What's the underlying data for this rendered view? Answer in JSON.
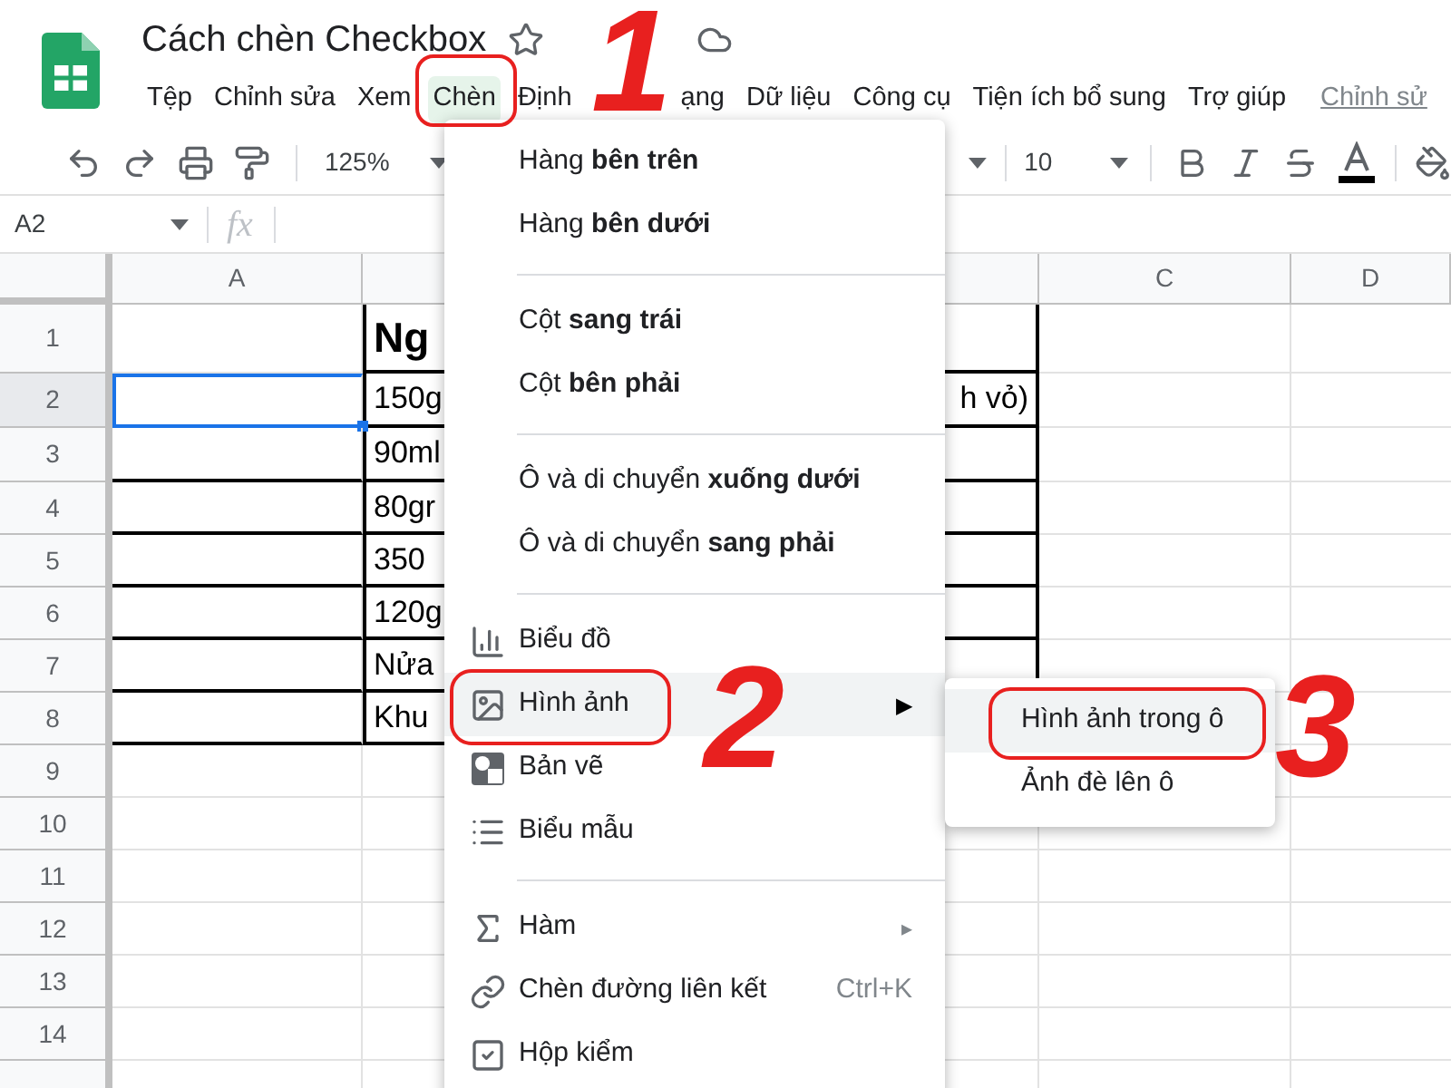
{
  "document": {
    "title": "Cách chèn Checkbox"
  },
  "menubar": [
    {
      "label": "Tệp",
      "selected": false
    },
    {
      "label": "Chỉnh sửa",
      "selected": false
    },
    {
      "label": "Xem",
      "selected": false
    },
    {
      "label": "Chèn",
      "selected": true
    },
    {
      "label": "Định",
      "label_end": "ạng",
      "selected": false
    },
    {
      "label": "Dữ liệu",
      "selected": false
    },
    {
      "label": "Công cụ",
      "selected": false
    },
    {
      "label": "Tiện ích bổ sung",
      "selected": false
    },
    {
      "label": "Trợ giúp",
      "selected": false
    }
  ],
  "last_edit_link": "Chỉnh sử",
  "toolbar": {
    "zoom": "125%",
    "font_size": "10"
  },
  "formula_bar": {
    "cell_ref": "A2",
    "fx_label": "fx"
  },
  "columns": [
    {
      "label": "A"
    },
    {},
    {
      "label": "C"
    },
    {
      "label": "D"
    }
  ],
  "rows": [
    {
      "number": "1",
      "selected": false,
      "column_b": "Ng",
      "bordered": true
    },
    {
      "number": "2",
      "selected": true,
      "column_b": "150g",
      "column_b_end": "h vỏ)",
      "bordered": true
    },
    {
      "number": "3",
      "selected": false,
      "column_b": "90ml",
      "bordered": true
    },
    {
      "number": "4",
      "selected": false,
      "column_b": "80gr",
      "bordered": true
    },
    {
      "number": "5",
      "selected": false,
      "column_b": "350",
      "bordered": true
    },
    {
      "number": "6",
      "selected": false,
      "column_b": "120g",
      "bordered": true
    },
    {
      "number": "7",
      "selected": false,
      "column_b": "Nửa",
      "bordered": true
    },
    {
      "number": "8",
      "selected": false,
      "column_b": "Khu",
      "bordered": true
    },
    {
      "number": "9",
      "selected": false,
      "bordered": false
    },
    {
      "number": "10",
      "selected": false,
      "bordered": false
    },
    {
      "number": "11",
      "selected": false,
      "bordered": false
    },
    {
      "number": "12",
      "selected": false,
      "bordered": false
    },
    {
      "number": "13",
      "selected": false,
      "bordered": false
    },
    {
      "number": "14",
      "selected": false,
      "bordered": false
    },
    {
      "selected": false,
      "bordered": false
    }
  ],
  "insert_menu": [
    {
      "kind": "plain",
      "label": "Hàng **bên trên**",
      "selected": false
    },
    {
      "kind": "plain",
      "label": "Hàng **bên dưới**",
      "selected": false
    },
    {
      "kind": "divider"
    },
    {
      "kind": "plain",
      "label": "Cột **sang trái**",
      "selected": false
    },
    {
      "kind": "plain",
      "label": "Cột **bên phải**",
      "selected": false
    },
    {
      "kind": "divider"
    },
    {
      "kind": "plain",
      "label": "Ô và di chuyển **xuống dưới**",
      "selected": false
    },
    {
      "kind": "plain",
      "label": "Ô và di chuyển **sang phải**",
      "selected": false
    },
    {
      "kind": "divider"
    },
    {
      "kind": "chart",
      "label": "Biểu đồ",
      "selected": false
    },
    {
      "kind": "image",
      "label": "Hình ảnh",
      "selected": true,
      "submenu_arrow": "▶"
    },
    {
      "kind": "drawing",
      "label": "Bản vẽ",
      "selected": false
    },
    {
      "kind": "form",
      "label": "Biểu mẫu",
      "selected": false
    },
    {
      "kind": "divider"
    },
    {
      "kind": "function",
      "label": "Hàm",
      "selected": false,
      "submenu_arrow": "▸"
    },
    {
      "kind": "link",
      "label": "Chèn đường liên kết",
      "selected": false,
      "shortcut": "Ctrl+K"
    },
    {
      "kind": "checkbox",
      "label": "Hộp kiểm",
      "selected": false
    }
  ],
  "image_submenu": [
    {
      "label": "Hình ảnh trong ô",
      "selected": true
    },
    {
      "label": "Ảnh đè lên ô",
      "selected": false
    }
  ],
  "annotations": [
    {
      "label": "1"
    },
    {
      "label": "2"
    },
    {
      "label": "3"
    }
  ]
}
